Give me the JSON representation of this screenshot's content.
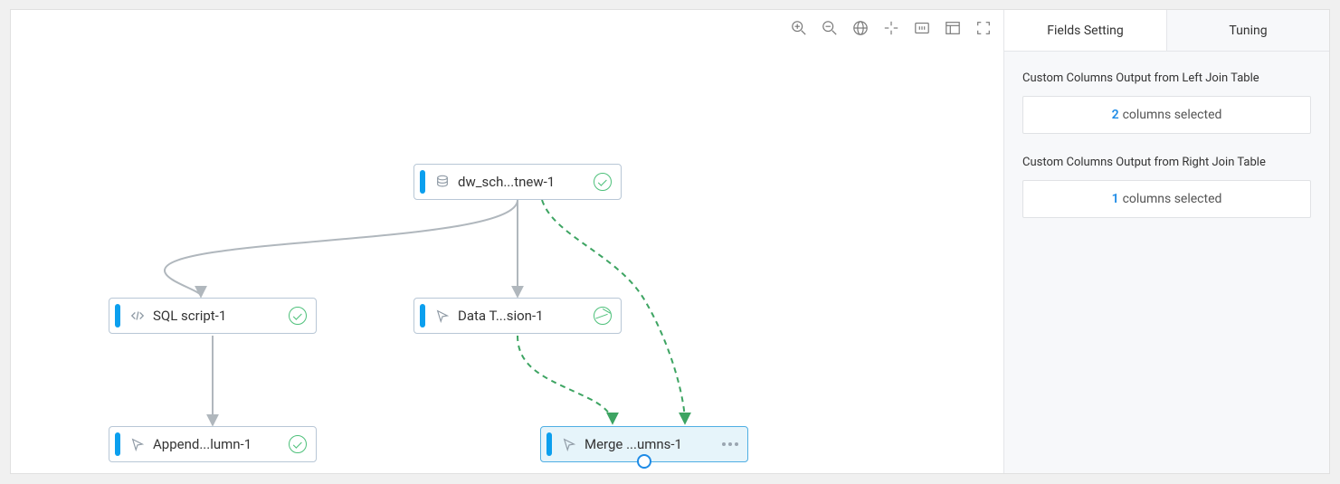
{
  "tabs": {
    "fields": "Fields Setting",
    "tuning": "Tuning"
  },
  "panel": {
    "left_label": "Custom Columns Output from Left Join Table",
    "left_count": "2",
    "left_text": "columns selected",
    "right_label": "Custom Columns Output from Right Join Table",
    "right_count": "1",
    "right_text": "columns selected"
  },
  "nodes": {
    "n1": {
      "label": "dw_sch...tnew-1"
    },
    "n2": {
      "label": "SQL script-1"
    },
    "n3": {
      "label": "Data T...sion-1"
    },
    "n4": {
      "label": "Append...lumn-1"
    },
    "n5": {
      "label": "Merge ...umns-1"
    }
  },
  "toolbar": {
    "zoom_in": "Zoom In",
    "zoom_out": "Zoom Out",
    "fit": "Fit",
    "center": "Recenter",
    "screen": "Actual Size",
    "layout": "Auto Layout",
    "fullscreen": "Fullscreen"
  }
}
